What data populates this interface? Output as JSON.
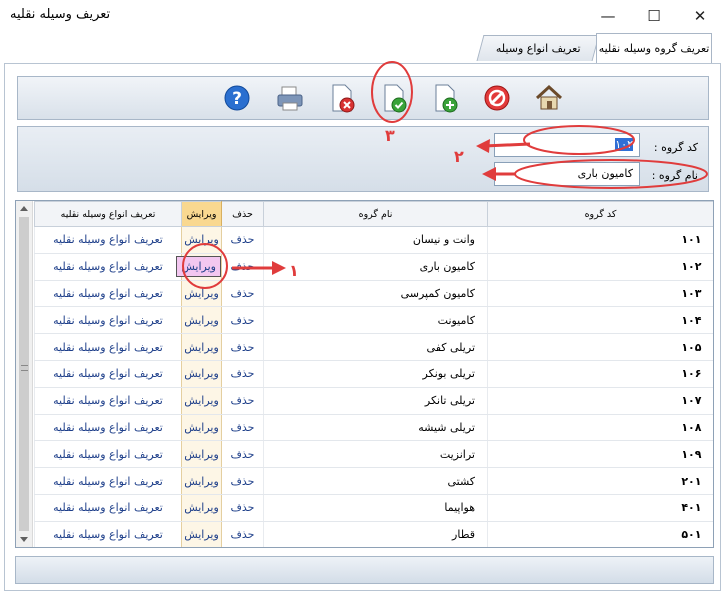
{
  "window": {
    "title": "تعریف وسیله نقلیه",
    "minimize_glyph": "—",
    "maximize_glyph": "☐",
    "close_glyph": "✕"
  },
  "tabs": [
    {
      "label": "تعریف گروه وسیله نقلیه",
      "active": true
    },
    {
      "label": "تعریف انواع وسیله",
      "active": false
    }
  ],
  "toolbar": {
    "icons": [
      "help-icon",
      "print-icon",
      "delete-doc-icon",
      "save-doc-icon",
      "add-doc-icon",
      "cancel-icon",
      "home-icon"
    ]
  },
  "form": {
    "code_label": "کد گروه :",
    "code_value": "۱۰۲",
    "name_label": "نام گروه :",
    "name_value": "کامیون باری"
  },
  "grid": {
    "columns": {
      "code": "کد گروه",
      "name": "نام گروه",
      "delete": "حذف",
      "edit": "ویرایش",
      "define": "تعریف انواع وسیله نقلیه"
    },
    "rows": [
      {
        "code": "۱۰۱",
        "name": "وانت و نیسان",
        "delete": "حذف",
        "edit": "ویرایش",
        "define": "تعریف انواع وسیله نقلیه"
      },
      {
        "code": "۱۰۲",
        "name": "کامیون باری",
        "delete": "حذف",
        "edit": "ویرایش",
        "define": "تعریف انواع وسیله نقلیه"
      },
      {
        "code": "۱۰۳",
        "name": "کامیون کمپرسی",
        "delete": "حذف",
        "edit": "ویرایش",
        "define": "تعریف انواع وسیله نقلیه"
      },
      {
        "code": "۱۰۴",
        "name": "کامیونت",
        "delete": "حذف",
        "edit": "ویرایش",
        "define": "تعریف انواع وسیله نقلیه"
      },
      {
        "code": "۱۰۵",
        "name": "تریلی کفی",
        "delete": "حذف",
        "edit": "ویرایش",
        "define": "تعریف انواع وسیله نقلیه"
      },
      {
        "code": "۱۰۶",
        "name": "تریلی بونکر",
        "delete": "حذف",
        "edit": "ویرایش",
        "define": "تعریف انواع وسیله نقلیه"
      },
      {
        "code": "۱۰۷",
        "name": "تریلی تانکر",
        "delete": "حذف",
        "edit": "ویرایش",
        "define": "تعریف انواع وسیله نقلیه"
      },
      {
        "code": "۱۰۸",
        "name": "تریلی شیشه",
        "delete": "حذف",
        "edit": "ویرایش",
        "define": "تعریف انواع وسیله نقلیه"
      },
      {
        "code": "۱۰۹",
        "name": "ترانزیت",
        "delete": "حذف",
        "edit": "ویرایش",
        "define": "تعریف انواع وسیله نقلیه"
      },
      {
        "code": "۲۰۱",
        "name": "کشتی",
        "delete": "حذف",
        "edit": "ویرایش",
        "define": "تعریف انواع وسیله نقلیه"
      },
      {
        "code": "۴۰۱",
        "name": "هواپیما",
        "delete": "حذف",
        "edit": "ویرایش",
        "define": "تعریف انواع وسیله نقلیه"
      },
      {
        "code": "۵۰۱",
        "name": "قطار",
        "delete": "حذف",
        "edit": "ویرایش",
        "define": "تعریف انواع وسیله نقلیه"
      }
    ]
  },
  "annotations": {
    "n1": "۱",
    "n2": "۲",
    "n3": "۳",
    "color": "#e03c3c"
  }
}
